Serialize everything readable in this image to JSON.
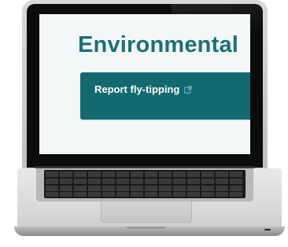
{
  "page": {
    "heading": "Environmental",
    "report_link": {
      "label": "Report fly-tipping",
      "icon": "external-link-icon"
    }
  },
  "colors": {
    "accent": "#126a70",
    "heading": "#1c6f77",
    "screen_background": "#f3f7f8"
  }
}
